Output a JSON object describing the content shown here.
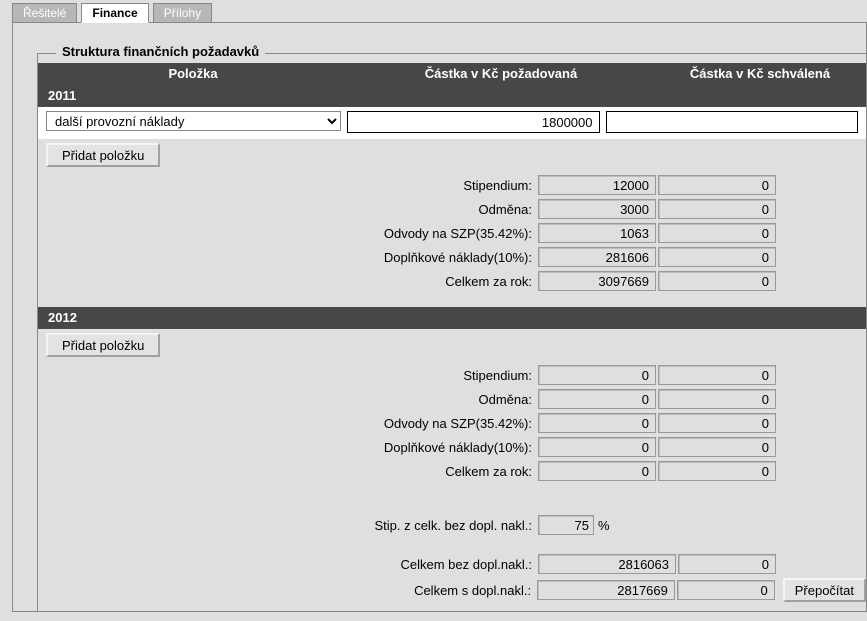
{
  "tabs": {
    "t0": "Řešitelé",
    "t1": "Finance",
    "t2": "Přílohy"
  },
  "fs_title": "Struktura finančních požadavků",
  "headers": {
    "c0": "Položka",
    "c1": "Částka v Kč požadovaná",
    "c2": "Částka v Kč schválená"
  },
  "year1": "2011",
  "item_select": "další provozní náklady",
  "item_requested": "1800000",
  "item_approved": "",
  "add_btn": "Přidat položku",
  "rows": [
    {
      "label": "Stipendium:",
      "v1": "12000",
      "v2": "0"
    },
    {
      "label": "Odměna:",
      "v1": "3000",
      "v2": "0"
    },
    {
      "label": "Odvody na SZP(35.42%):",
      "v1": "1063",
      "v2": "0"
    },
    {
      "label": "Doplňkové náklady(10%):",
      "v1": "281606",
      "v2": "0"
    },
    {
      "label": "Celkem za rok:",
      "v1": "3097669",
      "v2": "0"
    }
  ],
  "year2": "2012",
  "rows2": [
    {
      "label": "Stipendium:",
      "v1": "0",
      "v2": "0"
    },
    {
      "label": "Odměna:",
      "v1": "0",
      "v2": "0"
    },
    {
      "label": "Odvody na SZP(35.42%):",
      "v1": "0",
      "v2": "0"
    },
    {
      "label": "Doplňkové náklady(10%):",
      "v1": "0",
      "v2": "0"
    },
    {
      "label": "Celkem za rok:",
      "v1": "0",
      "v2": "0"
    }
  ],
  "pct_label": "Stip. z celk. bez dopl. nakl.:",
  "pct_value": "75",
  "pct_unit": "%",
  "totals": [
    {
      "label": "Celkem bez dopl.nakl.:",
      "v1": "2816063",
      "v2": "0"
    },
    {
      "label": "Celkem s dopl.nakl.:",
      "v1": "2817669",
      "v2": "0"
    }
  ],
  "recalc": "Přepočítat"
}
